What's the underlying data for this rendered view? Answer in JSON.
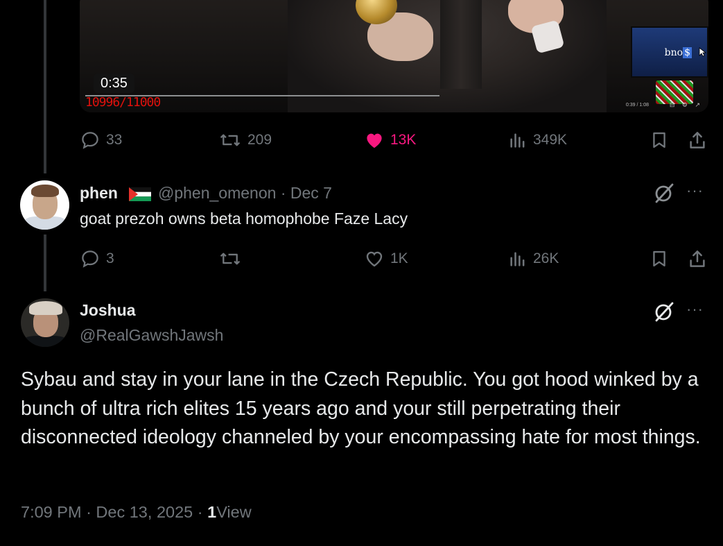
{
  "video": {
    "timestamp": "0:35",
    "counter": "10996/11000",
    "overlay_text": "bno",
    "overlay_highlight": "$",
    "mini_time": "0:39 / 1:08"
  },
  "main_tweet_actions": {
    "replies": "33",
    "reposts": "209",
    "likes": "13K",
    "views": "349K"
  },
  "reply": {
    "display_name": "phen",
    "handle": "@phen_omenon",
    "separator": "·",
    "date": "Dec 7",
    "text": "goat prezoh owns beta homophobe Faze Lacy",
    "actions": {
      "replies": "3",
      "reposts": "",
      "likes": "1K",
      "views": "26K"
    }
  },
  "focused_post": {
    "display_name": "Joshua",
    "handle": "@RealGawshJawsh",
    "text": "Sybau and stay in your lane in the Czech Republic. You got hood winked by a bunch of ultra rich elites 15 years ago and your still perpetrating their disconnected ideology channeled by your encompassing hate for most things.",
    "time": "7:09 PM",
    "sep1": "·",
    "date": "Dec 13, 2025",
    "sep2": "·",
    "view_count": "1",
    "view_label": "View"
  },
  "icons": {
    "more": "···"
  },
  "colors": {
    "background": "#000000",
    "text_primary": "#e7e9ea",
    "text_secondary": "#71767b",
    "like_pink": "#f91880",
    "thread_line": "#333639"
  }
}
